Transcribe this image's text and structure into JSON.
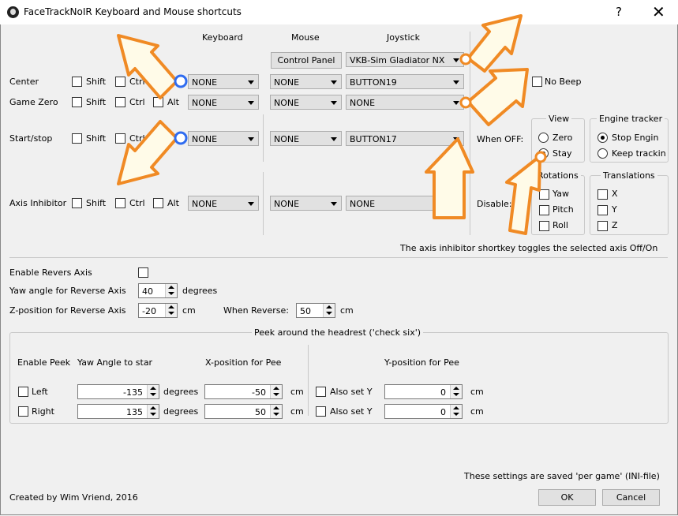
{
  "window": {
    "title": "FaceTrackNoIR Keyboard and Mouse shortcuts",
    "help": "?",
    "close": "✕"
  },
  "headers": {
    "keyboard": "Keyboard",
    "mouse": "Mouse",
    "joystick": "Joystick"
  },
  "top_buttons": {
    "control_panel": "Control Panel",
    "joystick_device": "VKB-Sim Gladiator NX"
  },
  "modifiers": {
    "shift": "Shift",
    "ctrl": "Ctrl",
    "alt": "Alt"
  },
  "rows": [
    {
      "label": "Center",
      "keyboard": "NONE",
      "mouse": "NONE",
      "joystick": "BUTTON19"
    },
    {
      "label": "Game Zero",
      "keyboard": "NONE",
      "mouse": "NONE",
      "joystick": "NONE"
    },
    {
      "label": "Start/stop",
      "keyboard": "NONE",
      "mouse": "NONE",
      "joystick": "BUTTON17"
    },
    {
      "label": "Axis Inhibitor",
      "keyboard": "NONE",
      "mouse": "NONE",
      "joystick": "NONE"
    }
  ],
  "no_beep": "No Beep",
  "when_off": "When OFF:",
  "disable": "Disable:",
  "view_group": {
    "title": "View",
    "zero": "Zero",
    "stay": "Stay",
    "selected": "Stay"
  },
  "engine_group": {
    "title": "Engine tracker",
    "stop": "Stop Engin",
    "keep": "Keep trackin",
    "selected": "Stop Engin"
  },
  "rotations_group": {
    "title": "Rotations",
    "yaw": "Yaw",
    "pitch": "Pitch",
    "roll": "Roll"
  },
  "translations_group": {
    "title": "Translations",
    "x": "X",
    "y": "Y",
    "z": "Z"
  },
  "inhibitor_note": "The axis inhibitor shortkey toggles the selected axis Off/On",
  "reverse": {
    "enable_label": "Enable Revers Axis",
    "yaw_label": "Yaw angle for Reverse Axis",
    "yaw_value": "40",
    "yaw_unit": "degrees",
    "z_label": "Z-position for Reverse Axis",
    "z_value": "-20",
    "z_unit": "cm",
    "when_label": "When Reverse:",
    "when_value": "50",
    "when_unit": "cm"
  },
  "peek": {
    "title": "Peek around the headrest ('check six')",
    "col_enable": "Enable Peek",
    "col_yaw": "Yaw Angle to star",
    "col_x": "X-position for Pee",
    "col_y": "Y-position for Pee",
    "rows": [
      {
        "label": "Left",
        "yaw": "-135",
        "yaw_unit": "degrees",
        "x": "-50",
        "x_unit": "cm",
        "also": "Also set Y",
        "y": "0",
        "y_unit": "cm"
      },
      {
        "label": "Right",
        "yaw": "135",
        "yaw_unit": "degrees",
        "x": "50",
        "x_unit": "cm",
        "also": "Also set Y",
        "y": "0",
        "y_unit": "cm"
      }
    ]
  },
  "footer": {
    "note": "These settings are saved 'per game' (INI-file)",
    "credit": "Created by Wim Vriend, 2016",
    "ok": "OK",
    "cancel": "Cancel"
  },
  "colors": {
    "highlight_blue": "#2f6cf0",
    "highlight_orange": "#f08a24"
  }
}
